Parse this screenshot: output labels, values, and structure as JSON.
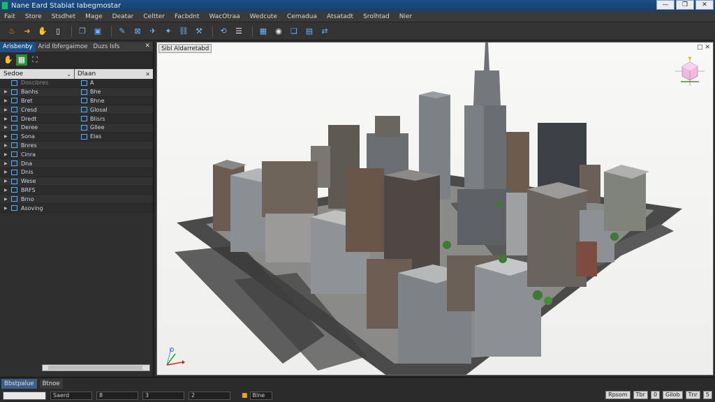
{
  "window": {
    "title": "Nane Eard Stabiat Iabegmostar",
    "buttons": [
      "—",
      "❐",
      "✕"
    ]
  },
  "menu": [
    "Fait",
    "Store",
    "Stsdhet",
    "Mage",
    "Deatar",
    "Celtter",
    "Facbdnt",
    "WacOtraa",
    "Wedcute",
    "Cemadua",
    "Atsatadt",
    "Srolhtad",
    "Nier"
  ],
  "left_panel": {
    "tabs": [
      "Arisbenby",
      "Arid Ibfergaimoe",
      "Duzs Isfs"
    ],
    "col1_label": "Sedoe",
    "col2_label": "Dlaan",
    "rows": [
      {
        "name": "Doscibres",
        "value": "A",
        "arrow": "",
        "header": true
      },
      {
        "name": "Banhs",
        "value": "Bhe",
        "arrow": "▶"
      },
      {
        "name": "Bret",
        "value": "Bhne",
        "arrow": "▶"
      },
      {
        "name": "Cresd",
        "value": "Glosal",
        "arrow": "▶"
      },
      {
        "name": "Dredt",
        "value": "Blisrs",
        "arrow": "▶"
      },
      {
        "name": "Deree",
        "value": "Gllee",
        "arrow": "▶"
      },
      {
        "name": "Sona",
        "value": "Elas",
        "arrow": "▶"
      },
      {
        "name": "Bnres",
        "value": "",
        "arrow": "▶"
      },
      {
        "name": "Cinra",
        "value": "",
        "arrow": "▶"
      },
      {
        "name": "Dna",
        "value": "",
        "arrow": "▶"
      },
      {
        "name": "Dnis",
        "value": "",
        "arrow": "▶"
      },
      {
        "name": "Wese",
        "value": "",
        "arrow": "▶"
      },
      {
        "name": "BRFS",
        "value": "",
        "arrow": "▶"
      },
      {
        "name": "Brno",
        "value": "",
        "arrow": "▶"
      },
      {
        "name": "Asoving",
        "value": "",
        "arrow": "▶"
      }
    ]
  },
  "viewport": {
    "label": "Sibl Aldarretabd",
    "controls": "□ ✕",
    "background_color": "#f3f3f1"
  },
  "status_bar": {
    "tabs": [
      "Bbstpalue",
      "Btnoe"
    ],
    "fields": [
      "Saerd",
      "8",
      "3",
      "2"
    ],
    "middle_label": "Blne",
    "right_buttons": [
      "Rpsom",
      "Tbr",
      "0",
      "Gilob",
      "Tnr",
      "5"
    ]
  },
  "colors": {
    "title_bar": "#1d4f86",
    "accent": "#1e4f86",
    "orange_icon": "#f0a21c",
    "blue_icon": "#69b6ff"
  },
  "icons": {
    "toolbar": [
      "flame-icon",
      "arrow-icon",
      "hand-icon",
      "page-icon",
      "copy-icon",
      "paste-icon",
      "pin-icon",
      "box-icon",
      "plane-icon",
      "merge-icon",
      "link-icon",
      "tool-icon",
      "refresh-icon",
      "list-icon",
      "chart-icon",
      "sphere-icon",
      "layers-icon",
      "camera-icon",
      "sync-icon"
    ]
  }
}
